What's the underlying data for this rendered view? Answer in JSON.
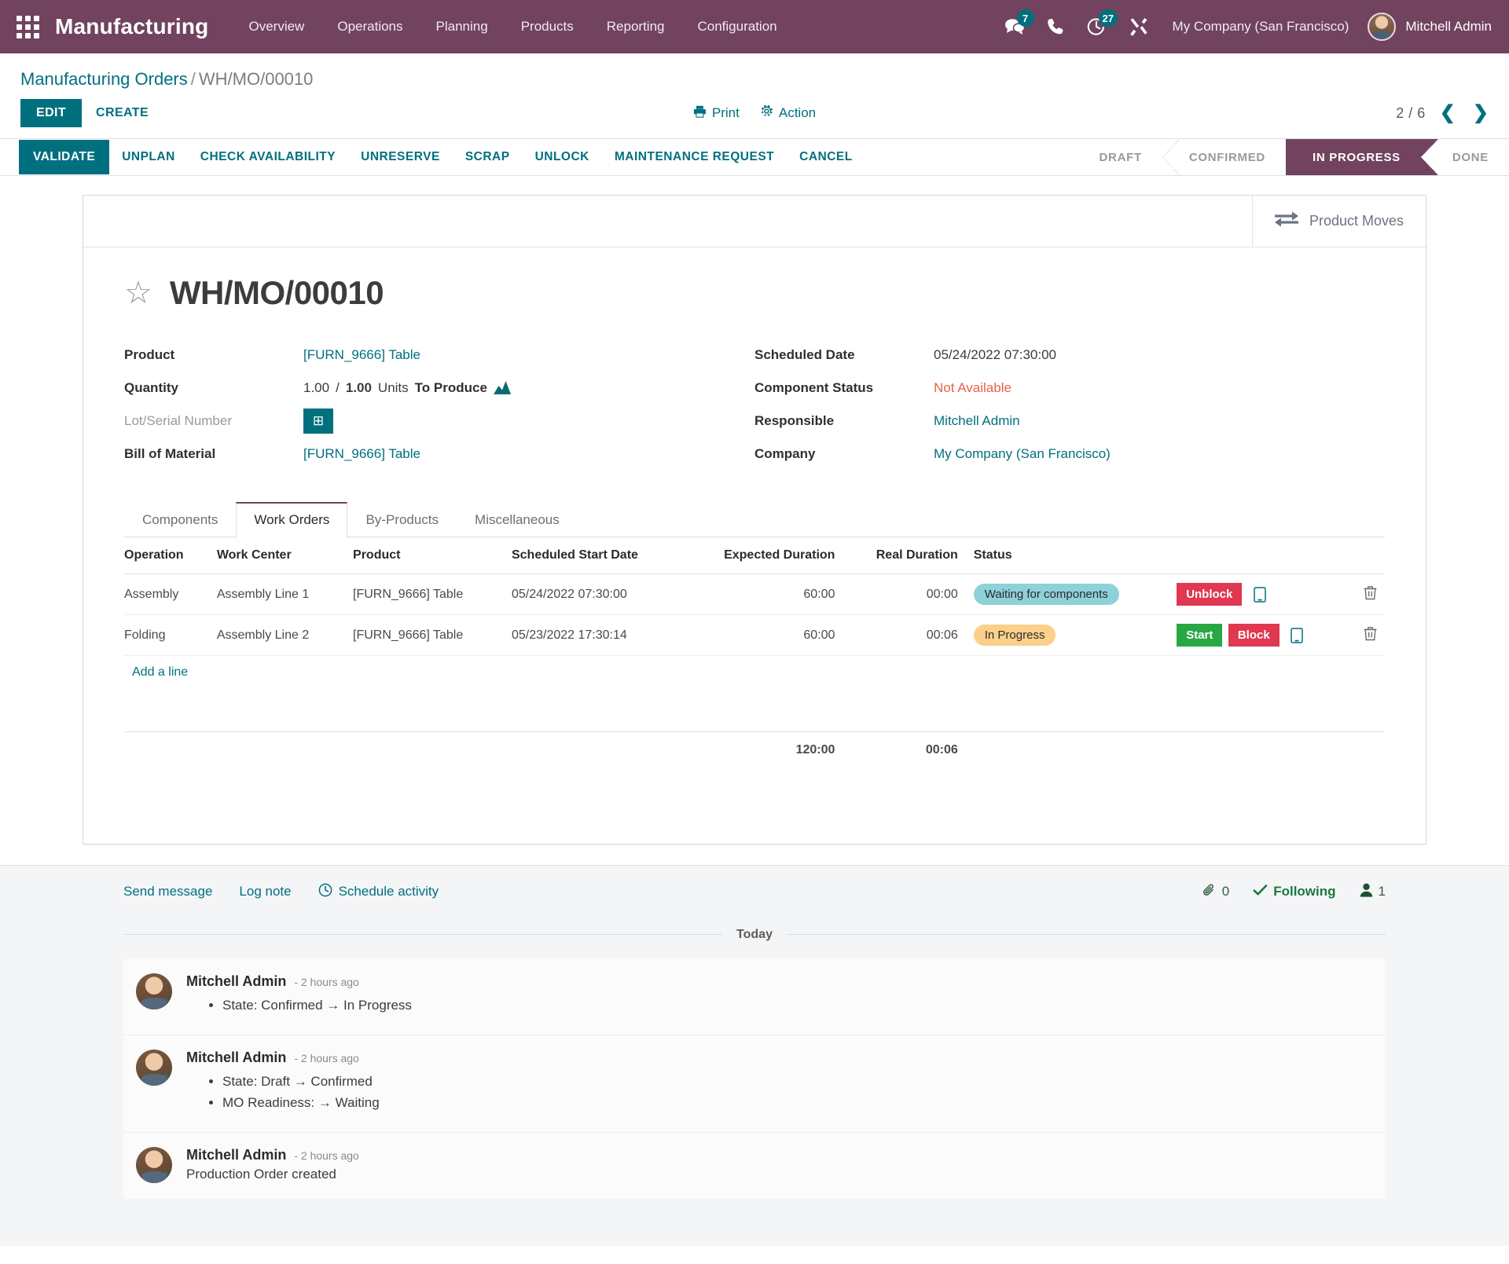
{
  "navbar": {
    "apps_icon": "apps-grid-icon",
    "brand": "Manufacturing",
    "menu": [
      {
        "label": "Overview"
      },
      {
        "label": "Operations"
      },
      {
        "label": "Planning"
      },
      {
        "label": "Products"
      },
      {
        "label": "Reporting"
      },
      {
        "label": "Configuration"
      }
    ],
    "icons": [
      {
        "name": "messages-icon",
        "badge": "7"
      },
      {
        "name": "phone-icon",
        "badge": ""
      },
      {
        "name": "activities-clock-icon",
        "badge": "27"
      },
      {
        "name": "debug-tools-icon",
        "badge": ""
      }
    ],
    "company": "My Company (San Francisco)",
    "user": "Mitchell Admin"
  },
  "breadcrumb": {
    "parent": "Manufacturing Orders",
    "separator": "/",
    "current": "WH/MO/00010"
  },
  "control": {
    "edit_label": "EDIT",
    "create_label": "CREATE",
    "print_label": "Print",
    "action_label": "Action",
    "pager": "2 / 6",
    "prev_icon": "❮",
    "next_icon": "❯"
  },
  "actions": {
    "primary": "VALIDATE",
    "buttons": [
      {
        "label": "UNPLAN"
      },
      {
        "label": "CHECK AVAILABILITY"
      },
      {
        "label": "UNRESERVE"
      },
      {
        "label": "SCRAP"
      },
      {
        "label": "UNLOCK"
      },
      {
        "label": "MAINTENANCE REQUEST"
      },
      {
        "label": "CANCEL"
      }
    ]
  },
  "stages": [
    {
      "label": "DRAFT",
      "active": false
    },
    {
      "label": "CONFIRMED",
      "active": false
    },
    {
      "label": "IN PROGRESS",
      "active": true
    },
    {
      "label": "DONE",
      "active": false
    }
  ],
  "stat_buttons": [
    {
      "label": "Product Moves",
      "icon": "exchange-arrows-icon"
    }
  ],
  "record": {
    "star_icon": "☆",
    "title": "WH/MO/00010"
  },
  "fields_left": {
    "product_label": "Product",
    "product_value": "[FURN_9666] Table",
    "quantity_label": "Quantity",
    "quantity_done": "1.00",
    "quantity_sep": "/",
    "quantity_total": "1.00",
    "quantity_uom": "Units",
    "quantity_suffix": "To Produce",
    "lot_label": "Lot/Serial Number",
    "lot_button_icon": "⊞",
    "bom_label": "Bill of Material",
    "bom_value": "[FURN_9666] Table"
  },
  "fields_right": {
    "scheduled_label": "Scheduled Date",
    "scheduled_value": "05/24/2022 07:30:00",
    "component_label": "Component Status",
    "component_value": "Not Available",
    "responsible_label": "Responsible",
    "responsible_value": "Mitchell Admin",
    "company_label": "Company",
    "company_value": "My Company (San Francisco)"
  },
  "tabs": [
    {
      "label": "Components",
      "active": false
    },
    {
      "label": "Work Orders",
      "active": true
    },
    {
      "label": "By-Products",
      "active": false
    },
    {
      "label": "Miscellaneous",
      "active": false
    }
  ],
  "work_orders": {
    "columns": [
      "Operation",
      "Work Center",
      "Product",
      "Scheduled Start Date",
      "Expected Duration",
      "Real Duration",
      "Status"
    ],
    "rows": [
      {
        "operation": "Assembly",
        "work_center": "Assembly Line 1",
        "product": "[FURN_9666] Table",
        "scheduled_start": "05/24/2022 07:30:00",
        "expected_duration": "60:00",
        "real_duration": "00:00",
        "status": "Waiting for components",
        "status_style": "waiting",
        "buttons": [
          {
            "label": "Unblock",
            "style": "danger"
          }
        ]
      },
      {
        "operation": "Folding",
        "work_center": "Assembly Line 2",
        "product": "[FURN_9666] Table",
        "scheduled_start": "05/23/2022 17:30:14",
        "expected_duration": "60:00",
        "real_duration": "00:06",
        "status": "In Progress",
        "status_style": "progress",
        "buttons": [
          {
            "label": "Start",
            "style": "success"
          },
          {
            "label": "Block",
            "style": "danger"
          }
        ]
      }
    ],
    "add_line": "Add a line",
    "total_expected": "120:00",
    "total_real": "00:06"
  },
  "chatter": {
    "send_message": "Send message",
    "log_note": "Log note",
    "schedule_activity": "Schedule activity",
    "attachment_count": "0",
    "following_label": "Following",
    "follower_count": "1",
    "today_label": "Today",
    "messages": [
      {
        "author": "Mitchell Admin",
        "time": "- 2 hours ago",
        "lines": [
          "State: Confirmed → In Progress"
        ]
      },
      {
        "author": "Mitchell Admin",
        "time": "- 2 hours ago",
        "lines": [
          "State: Draft → Confirmed",
          "MO Readiness: → Waiting"
        ]
      },
      {
        "author": "Mitchell Admin",
        "time": "- 2 hours ago",
        "plain": "Production Order created"
      }
    ]
  },
  "colors": {
    "brand_purple": "#71435f",
    "accent_teal": "#00707f",
    "danger": "#e03851",
    "success": "#28a745",
    "waiting_badge": "#8ed1d8",
    "progress_badge": "#fbd08a",
    "component_status": "#e8604a"
  }
}
